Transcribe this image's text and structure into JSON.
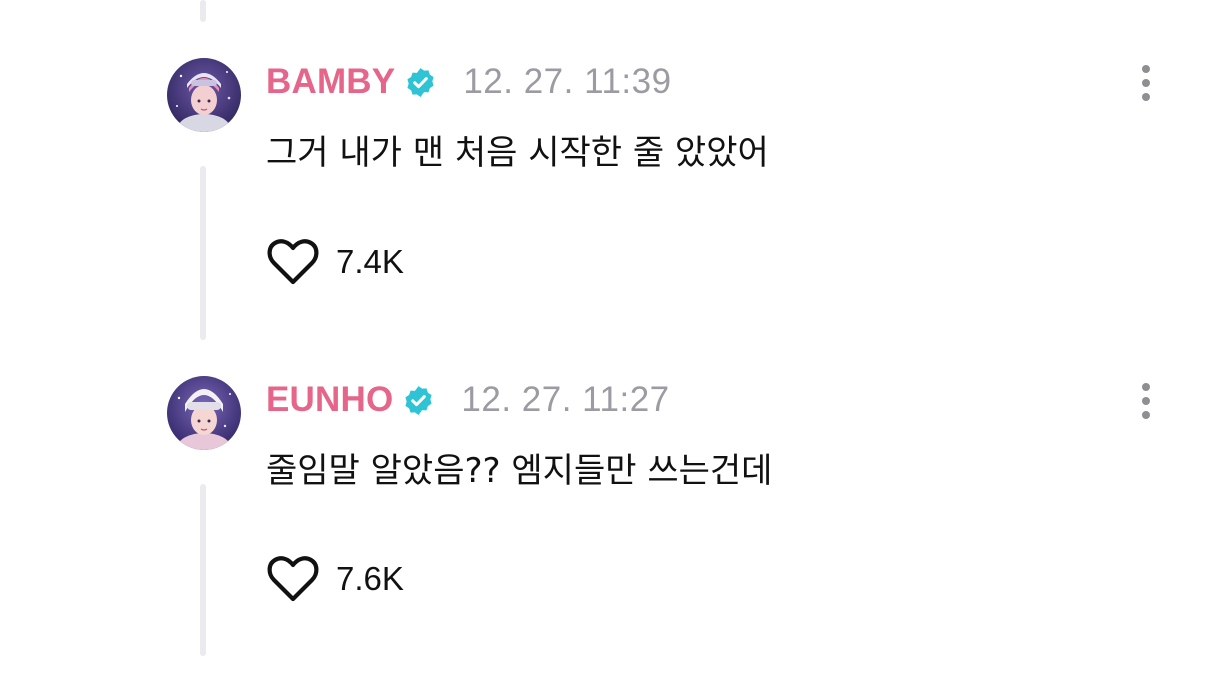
{
  "comments": [
    {
      "username": "BAMBY",
      "verified": true,
      "timestamp": "12. 27. 11:39",
      "text": "그거 내가 맨 처음 시작한 줄 았았어",
      "likes": "7.4K",
      "liked": false
    },
    {
      "username": "EUNHO",
      "verified": true,
      "timestamp": "12. 27. 11:27",
      "text": "줄임말 알았음?? 엠지들만 쓰는건데",
      "likes": "7.6K",
      "liked": false
    }
  ],
  "icons": {
    "verified": "check-badge-icon",
    "like": "heart-outline-icon",
    "more": "vertical-ellipsis-icon"
  },
  "colors": {
    "username": "#e5668a",
    "verified_badge": "#2ec4d6",
    "timestamp": "#9b9ba3",
    "text": "#111111",
    "thread_line": "#ebebef",
    "more_icon": "#8e8e93"
  }
}
